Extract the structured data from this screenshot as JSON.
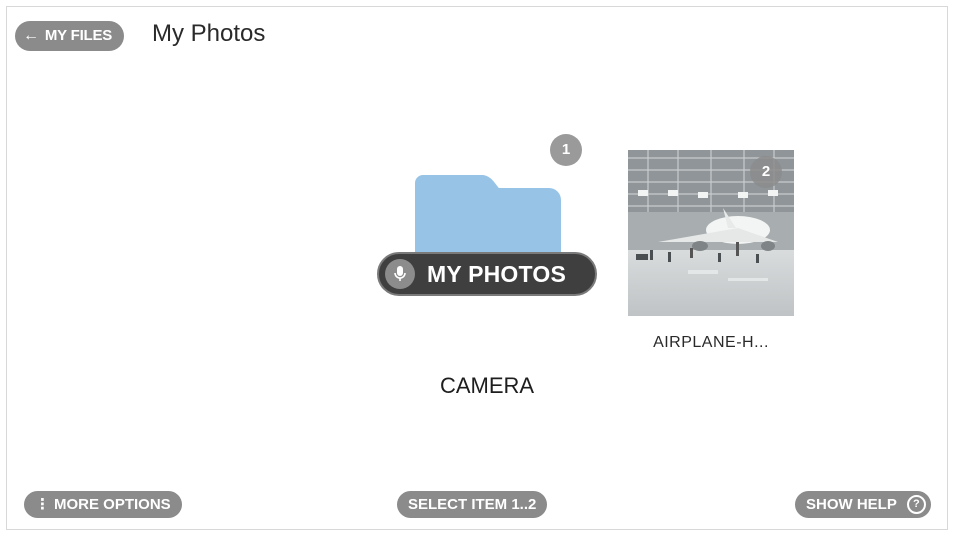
{
  "header": {
    "back_label": "MY FILES",
    "title": "My Photos"
  },
  "items": [
    {
      "kind": "folder",
      "badge": "1",
      "label": "CAMERA",
      "voice_label": "MY PHOTOS"
    },
    {
      "kind": "photo",
      "badge": "2",
      "label": "AIRPLANE-H..."
    }
  ],
  "footer": {
    "more_options": "MORE OPTIONS",
    "select_items": "SELECT ITEM 1..2",
    "show_help": "SHOW HELP",
    "help_glyph": "?"
  },
  "colors": {
    "pill_gray": "#8b8b8b",
    "voice_pill": "#3f3f3f",
    "folder_blue": "#97c4e6"
  },
  "icons": {
    "back": "back-arrow-icon",
    "mic": "microphone-icon",
    "more": "more-vertical-icon",
    "help": "help-icon",
    "folder": "folder-icon"
  }
}
